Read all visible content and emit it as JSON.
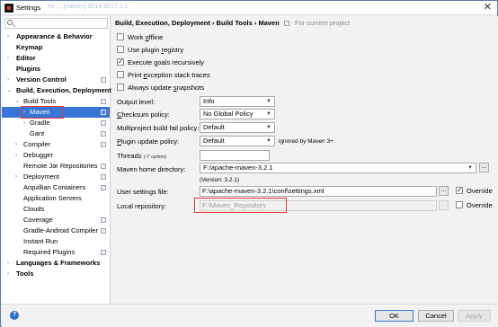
{
  "window": {
    "title": "Settings",
    "title_extra": "for ... [maven] 2014.3017.1.1",
    "close_symbol": "✕"
  },
  "sidebar": {
    "items": [
      {
        "label": "Appearance & Behavior",
        "arrow": "›"
      },
      {
        "label": "Keymap",
        "arrow": ""
      },
      {
        "label": "Editor",
        "arrow": "›"
      },
      {
        "label": "Plugins",
        "arrow": ""
      },
      {
        "label": "Version Control",
        "arrow": "›"
      },
      {
        "label": "Build, Execution, Deployment",
        "arrow": "⌄"
      },
      {
        "label": "Build Tools",
        "arrow": "⌄"
      },
      {
        "label": "Maven",
        "arrow": "›"
      },
      {
        "label": "Gradle",
        "arrow": "›"
      },
      {
        "label": "Gant",
        "arrow": ""
      },
      {
        "label": "Compiler",
        "arrow": "›"
      },
      {
        "label": "Debugger",
        "arrow": "›"
      },
      {
        "label": "Remote Jar Repositories",
        "arrow": ""
      },
      {
        "label": "Deployment",
        "arrow": "›"
      },
      {
        "label": "Arquillian Containers",
        "arrow": ""
      },
      {
        "label": "Application Servers",
        "arrow": ""
      },
      {
        "label": "Clouds",
        "arrow": ""
      },
      {
        "label": "Coverage",
        "arrow": ""
      },
      {
        "label": "Gradle-Android Compiler",
        "arrow": ""
      },
      {
        "label": "Instant Run",
        "arrow": ""
      },
      {
        "label": "Required Plugins",
        "arrow": ""
      },
      {
        "label": "Languages & Frameworks",
        "arrow": "›"
      },
      {
        "label": "Tools",
        "arrow": "›"
      }
    ]
  },
  "main": {
    "breadcrumb": "Build, Execution, Deployment › Build Tools › Maven",
    "breadcrumb_hint": "For current project",
    "checkboxes": {
      "work_offline": {
        "pre": "Work ",
        "u": "o",
        "post": "ffline"
      },
      "use_plugin_registry": {
        "pre": "Use plugin ",
        "u": "r",
        "post": "egistry"
      },
      "execute_goals": {
        "pre": "Execute ",
        "u": "g",
        "post": "oals recursively"
      },
      "print_exception": {
        "pre": "Print ",
        "u": "e",
        "post": "xception stack traces"
      },
      "always_update": {
        "pre": "Always update ",
        "u": "s",
        "post": "napshots"
      }
    },
    "output_level": {
      "label": "Output level:",
      "value": "Info"
    },
    "checksum_policy": {
      "label_u": "C",
      "label_rest": "hecksum policy:",
      "value": "No Global Policy"
    },
    "multiproject_policy": {
      "label": "Multiproject build fail policy:",
      "value": "Default"
    },
    "plugin_update_policy": {
      "label_u": "P",
      "label_rest": "lugin update policy:",
      "value": "Default",
      "note": "ignored by Maven 3+"
    },
    "threads": {
      "label": "Threads ",
      "hint": "(-T option)",
      "value": ""
    },
    "maven_home": {
      "label": "Maven home directory:",
      "value": "F:/apache-maven-3.2.1",
      "version": "(Version: 3.2.1)"
    },
    "user_settings": {
      "label": "User settings file:",
      "value": "F:\\apache-maven-3.2.1\\conf\\settings.xml",
      "override": "Override"
    },
    "local_repo": {
      "label": "Local repository:",
      "value": "F:\\Maven_Repository",
      "override": "Override"
    },
    "browse_label": "..."
  },
  "buttons": {
    "help": "?",
    "ok": "OK",
    "cancel": "Cancel",
    "apply": "Apply"
  },
  "colors": {
    "selection": "#3875d7",
    "highlight_box": "#e53935"
  }
}
